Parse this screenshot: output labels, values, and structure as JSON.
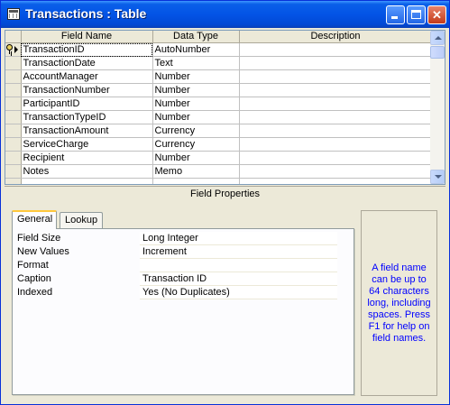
{
  "window": {
    "title": "Transactions : Table"
  },
  "grid": {
    "headers": [
      "Field Name",
      "Data Type",
      "Description"
    ],
    "rows": [
      {
        "field": "TransactionID",
        "type": "AutoNumber",
        "desc": ""
      },
      {
        "field": "TransactionDate",
        "type": "Text",
        "desc": ""
      },
      {
        "field": "AccountManager",
        "type": "Number",
        "desc": ""
      },
      {
        "field": "TransactionNumber",
        "type": "Number",
        "desc": ""
      },
      {
        "field": "ParticipantID",
        "type": "Number",
        "desc": ""
      },
      {
        "field": "TransactionTypeID",
        "type": "Number",
        "desc": ""
      },
      {
        "field": "TransactionAmount",
        "type": "Currency",
        "desc": ""
      },
      {
        "field": "ServiceCharge",
        "type": "Currency",
        "desc": ""
      },
      {
        "field": "Recipient",
        "type": "Number",
        "desc": ""
      },
      {
        "field": "Notes",
        "type": "Memo",
        "desc": ""
      },
      {
        "field": "",
        "type": "",
        "desc": ""
      },
      {
        "field": "",
        "type": "",
        "desc": ""
      }
    ]
  },
  "field_properties": {
    "header": "Field Properties",
    "tabs": [
      "General",
      "Lookup"
    ],
    "properties": [
      {
        "label": "Field Size",
        "value": "Long Integer"
      },
      {
        "label": "New Values",
        "value": "Increment"
      },
      {
        "label": "Format",
        "value": ""
      },
      {
        "label": "Caption",
        "value": "Transaction ID"
      },
      {
        "label": "Indexed",
        "value": "Yes (No Duplicates)"
      }
    ]
  },
  "help_text": "A field name can be up to 64 characters long, including spaces. Press F1 for help on field names.",
  "colors": {
    "title_bar": "#0354e6",
    "help_text": "#0000ff",
    "active_tab_accent": "#ffc83c"
  }
}
